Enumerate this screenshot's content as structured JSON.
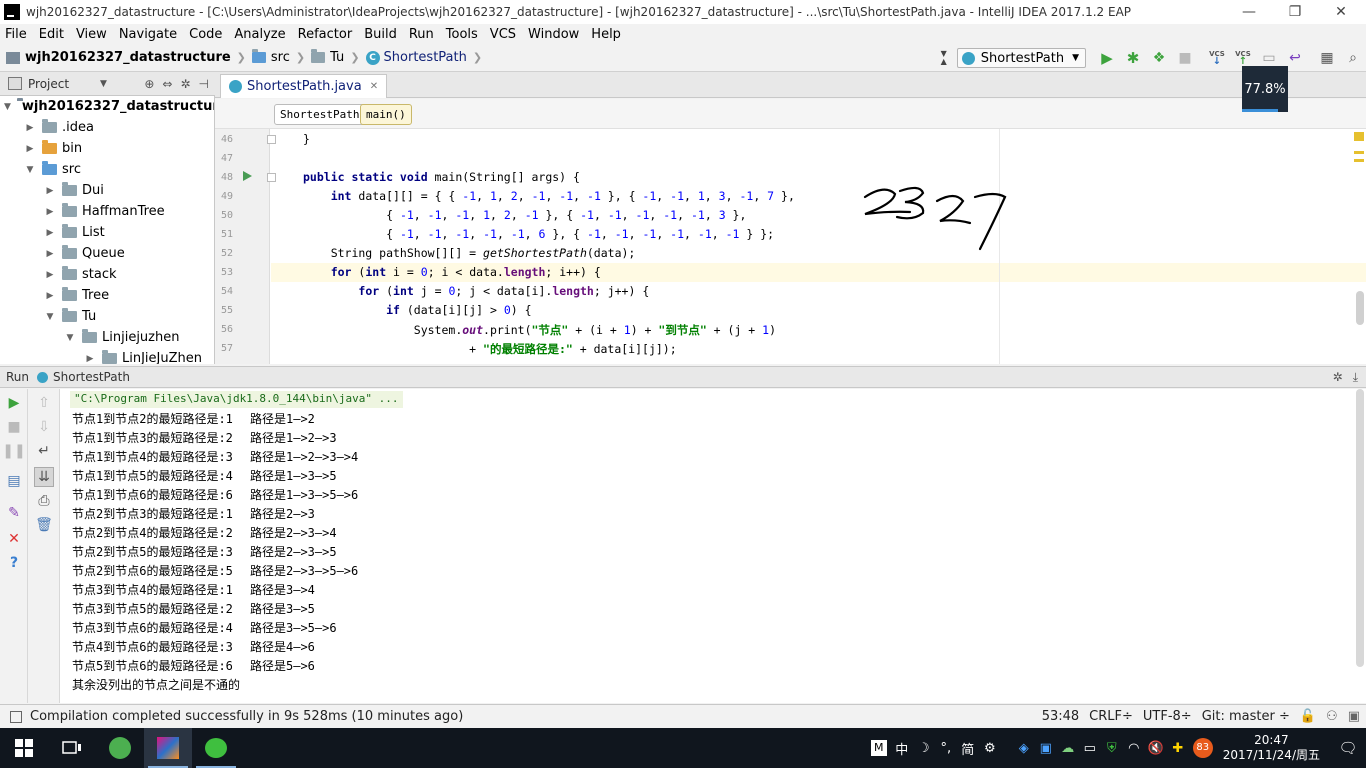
{
  "window": {
    "title": "wjh20162327_datastructure - [C:\\Users\\Administrator\\IdeaProjects\\wjh20162327_datastructure] - [wjh20162327_datastructure] - ...\\src\\Tu\\ShortestPath.java - IntelliJ IDEA 2017.1.2 EAP",
    "minimize": "—",
    "maximize": "❐",
    "close": "✕"
  },
  "menu": [
    "File",
    "Edit",
    "View",
    "Navigate",
    "Code",
    "Analyze",
    "Refactor",
    "Build",
    "Run",
    "Tools",
    "VCS",
    "Window",
    "Help"
  ],
  "nav": {
    "project": "wjh20162327_datastructure",
    "src": "src",
    "package": "Tu",
    "class": "ShortestPath",
    "run_config": "ShortestPath"
  },
  "cpu": {
    "label": "77.8%",
    "value": 77.8
  },
  "project_panel": {
    "title": "Project",
    "tree": [
      {
        "label": "wjh20162327_datastructure",
        "depth": 0,
        "expanded": true,
        "type": "project",
        "bold": true
      },
      {
        "label": ".idea",
        "depth": 1,
        "expanded": false,
        "type": "folder"
      },
      {
        "label": "bin",
        "depth": 1,
        "expanded": false,
        "type": "folder-orange"
      },
      {
        "label": "src",
        "depth": 1,
        "expanded": true,
        "type": "folder-blue"
      },
      {
        "label": "Dui",
        "depth": 2,
        "expanded": false,
        "type": "folder"
      },
      {
        "label": "HaffmanTree",
        "depth": 2,
        "expanded": false,
        "type": "folder"
      },
      {
        "label": "List",
        "depth": 2,
        "expanded": false,
        "type": "folder"
      },
      {
        "label": "Queue",
        "depth": 2,
        "expanded": false,
        "type": "folder"
      },
      {
        "label": "stack",
        "depth": 2,
        "expanded": false,
        "type": "folder"
      },
      {
        "label": "Tree",
        "depth": 2,
        "expanded": false,
        "type": "folder"
      },
      {
        "label": "Tu",
        "depth": 2,
        "expanded": true,
        "type": "folder"
      },
      {
        "label": "Linjiejuzhen",
        "depth": 3,
        "expanded": true,
        "type": "folder"
      },
      {
        "label": "LinJieJuZhen",
        "depth": 4,
        "expanded": false,
        "type": "folder"
      }
    ]
  },
  "editor": {
    "tab": "ShortestPath.java",
    "crumbs": [
      "ShortestPath",
      "main()"
    ],
    "line_numbers": [
      "46",
      "47",
      "48",
      "49",
      "50",
      "51",
      "52",
      "53",
      "54",
      "55",
      "56",
      "57"
    ],
    "handwriting": "2327"
  },
  "run_panel": {
    "title": "Run",
    "tab": "ShortestPath",
    "command": "\"C:\\Program Files\\Java\\jdk1.8.0_144\\bin\\java\" ...",
    "output": [
      {
        "a": "节点1到节点2的最短路径是:1",
        "b": "路径是1—>2"
      },
      {
        "a": "节点1到节点3的最短路径是:2",
        "b": "路径是1—>2—>3"
      },
      {
        "a": "节点1到节点4的最短路径是:3",
        "b": "路径是1—>2—>3—>4"
      },
      {
        "a": "节点1到节点5的最短路径是:4",
        "b": "路径是1—>3—>5"
      },
      {
        "a": "节点1到节点6的最短路径是:6",
        "b": "路径是1—>3—>5—>6"
      },
      {
        "a": "节点2到节点3的最短路径是:1",
        "b": "路径是2—>3"
      },
      {
        "a": "节点2到节点4的最短路径是:2",
        "b": "路径是2—>3—>4"
      },
      {
        "a": "节点2到节点5的最短路径是:3",
        "b": "路径是2—>3—>5"
      },
      {
        "a": "节点2到节点6的最短路径是:5",
        "b": "路径是2—>3—>5—>6"
      },
      {
        "a": "节点3到节点4的最短路径是:1",
        "b": "路径是3—>4"
      },
      {
        "a": "节点3到节点5的最短路径是:2",
        "b": "路径是3—>5"
      },
      {
        "a": "节点3到节点6的最短路径是:4",
        "b": "路径是3—>5—>6"
      },
      {
        "a": "节点4到节点6的最短路径是:3",
        "b": "路径是4—>6"
      },
      {
        "a": "节点5到节点6的最短路径是:6",
        "b": "路径是5—>6"
      },
      {
        "a": "其余没列出的节点之间是不通的",
        "b": ""
      }
    ]
  },
  "status": {
    "message": "Compilation completed successfully in 9s 528ms (10 minutes ago)",
    "position": "53:48",
    "line_sep": "CRLF÷",
    "encoding": "UTF-8÷",
    "git": "Git: master ÷"
  },
  "taskbar": {
    "ime_mode": "M",
    "ime_lang": "中",
    "ime_simp": "简",
    "battery": "83",
    "time": "20:47",
    "date": "2017/11/24/周五"
  }
}
